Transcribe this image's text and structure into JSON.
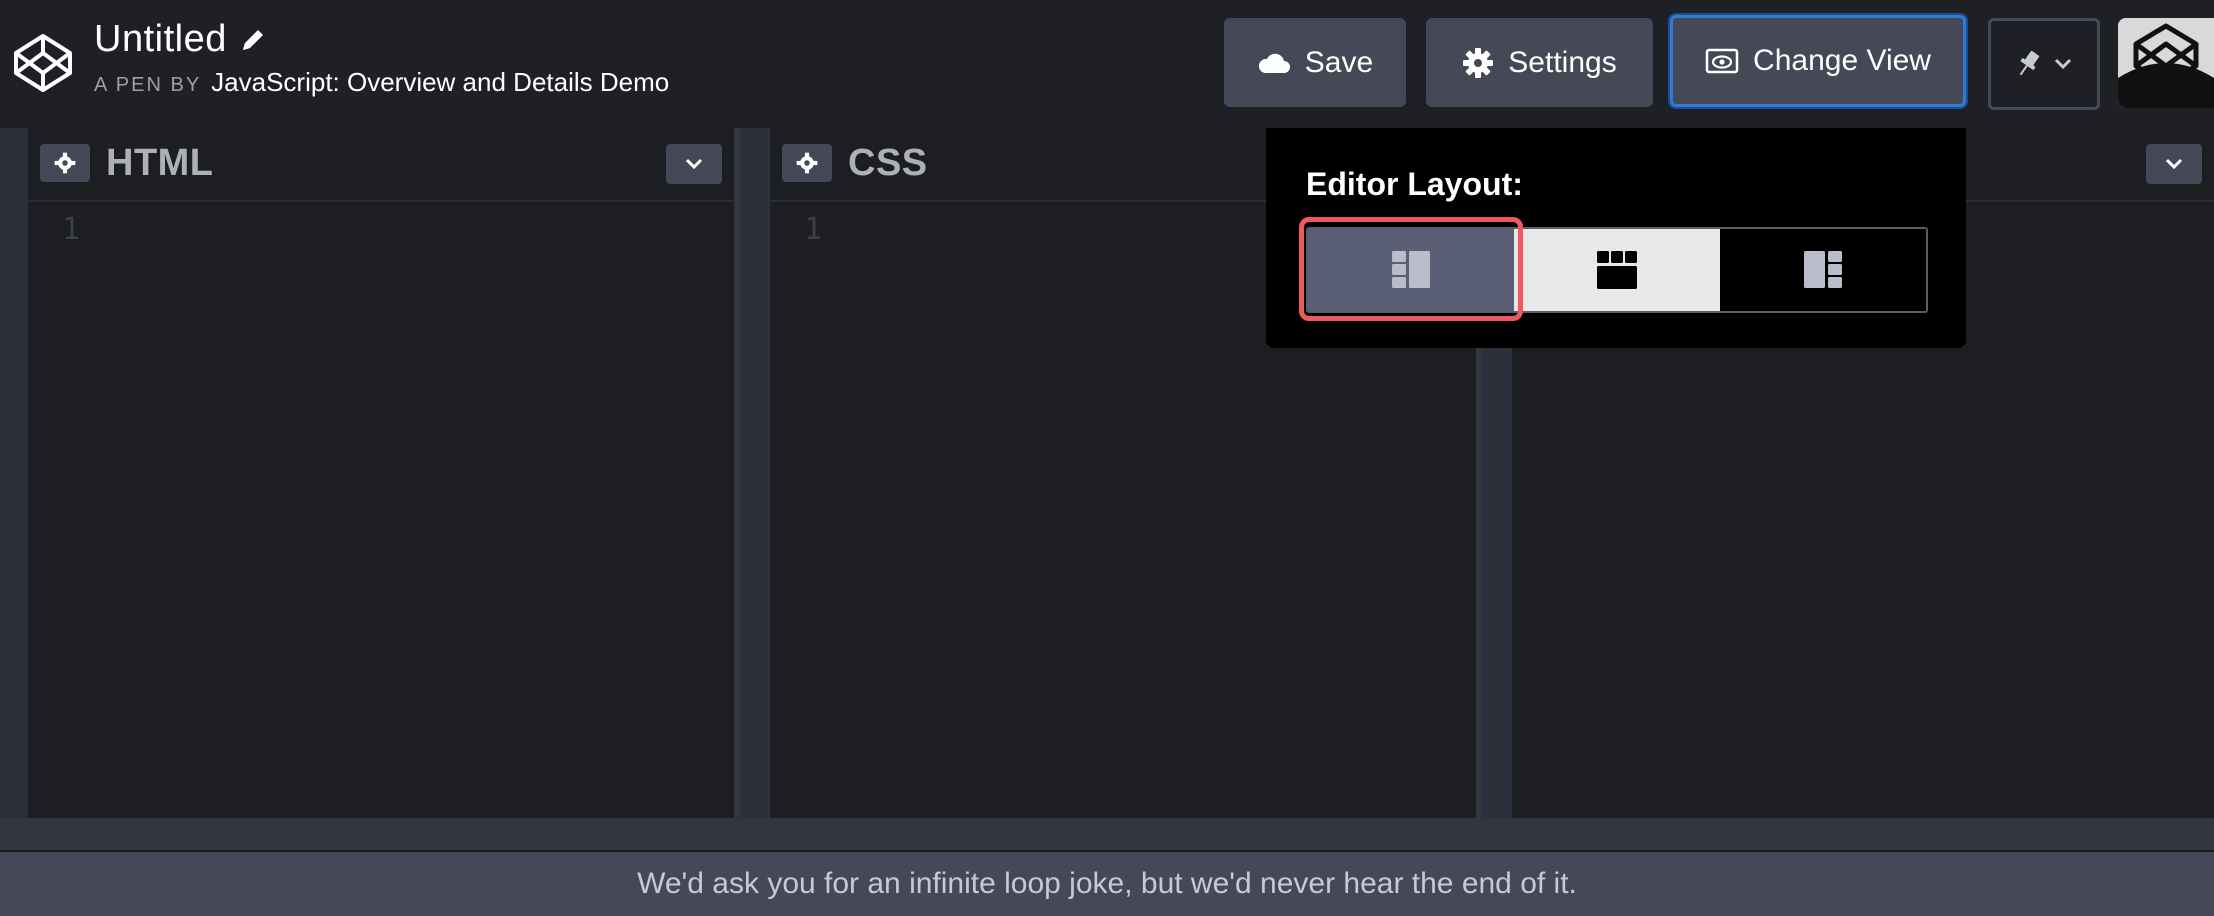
{
  "header": {
    "title": "Untitled",
    "byline_prefix": "A PEN BY",
    "author": "JavaScript: Overview and Details Demo",
    "buttons": {
      "save": "Save",
      "settings": "Settings",
      "change_view": "Change View"
    }
  },
  "editors": [
    {
      "lang": "HTML",
      "line": "1"
    },
    {
      "lang": "CSS",
      "line": "1"
    }
  ],
  "layout_popup": {
    "title": "Editor Layout:",
    "options": [
      "left-layout-icon",
      "top-layout-icon",
      "right-layout-icon"
    ],
    "selected": 0
  },
  "footer": {
    "message": "We'd ask you for an infinite loop joke, but we'd never hear the end of it."
  },
  "colors": {
    "accent_focus": "#2f7bd6",
    "highlight": "#f0585f",
    "button_bg": "#444857"
  }
}
